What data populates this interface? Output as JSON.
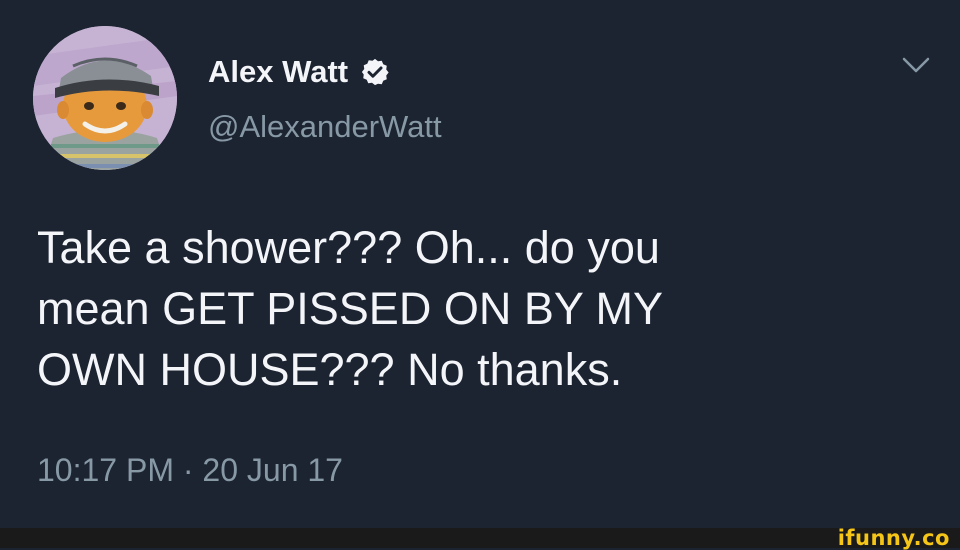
{
  "tweet": {
    "display_name": "Alex Watt",
    "handle": "@AlexanderWatt",
    "text_lines": [
      "Take a shower??? Oh... do you",
      "mean GET PISSED ON BY MY",
      "OWN HOUSE??? No thanks."
    ],
    "timestamp": "10:17 PM · 20 Jun 17",
    "verified": true,
    "icons": {
      "verified": "verified-badge-icon",
      "menu": "chevron-down-icon"
    }
  },
  "watermark": {
    "text": "ifunny.co"
  },
  "colors": {
    "background": "#1c2331",
    "primary_text": "#f3f5f8",
    "secondary_text": "#8899a6",
    "watermark": "#f5c518",
    "footer_bar": "#1a1a1a"
  }
}
